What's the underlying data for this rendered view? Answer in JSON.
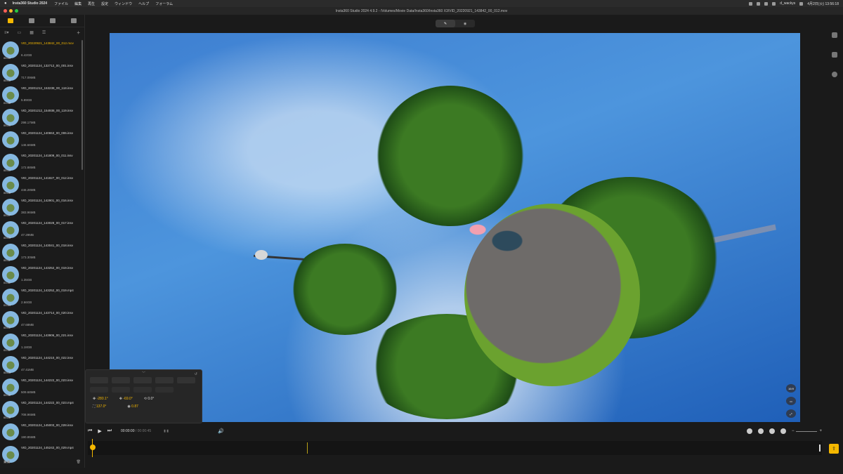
{
  "menubar": {
    "app_name": "Insta360 Studio 2024",
    "menus": [
      "ファイル",
      "編集",
      "再生",
      "設定",
      "ウィンドウ",
      "ヘルプ",
      "フォーラム"
    ],
    "user": "d_wackys",
    "datetime": "4月2日(火) 13:56:18"
  },
  "window": {
    "title": "Insta360 Studio 2024 4.9.2 - /Volumes/Movie Data/Insta360/Insta360 X3/VID_20220921_143842_00_012.mov"
  },
  "sidebar": {
    "files": [
      {
        "name": "VID_20220921_143842_00_012.mov",
        "size": "6.42GB",
        "duration": "00:45",
        "selected": true
      },
      {
        "name": "VID_20201124_132712_00_001.insv",
        "size": "717.09MB",
        "duration": "00:05"
      },
      {
        "name": "VID_20201212_153238_00_118.insv",
        "size": "5.89GB",
        "duration": "01:48"
      },
      {
        "name": "VID_20201212_154938_00_119.insv",
        "size": "298.17MB",
        "duration": "00:20"
      },
      {
        "name": "VID_20201124_140653_00_006.insv",
        "size": "146.66MB",
        "duration": ""
      },
      {
        "name": "VID_20201124_141809_00_011.insv",
        "size": "172.88MB",
        "duration": "00:10"
      },
      {
        "name": "VID_20201124_141827_00_012.insv",
        "size": "446.28MB",
        "duration": "00:26"
      },
      {
        "name": "VID_20201124_142901_00_016.insv",
        "size": "383.96MB",
        "duration": "00:27"
      },
      {
        "name": "VID_20201124_143028_00_017.insv",
        "size": "47.29MB",
        "duration": "00:03"
      },
      {
        "name": "VID_20201124_143041_00_018.insv",
        "size": "173.30MB",
        "duration": "00:11"
      },
      {
        "name": "VID_20201124_143252_00_019.insv",
        "size": "1.35GB",
        "duration": "01:31"
      },
      {
        "name": "VID_20201124_143252_00_019.mp4",
        "size": "2.66GB",
        "duration": "01:44"
      },
      {
        "name": "VID_20201124_143714_00_020.insv",
        "size": "47.68MB",
        "duration": "00:01"
      },
      {
        "name": "VID_20201124_143906_00_021.insv",
        "size": "1.18GB",
        "duration": "01:31"
      },
      {
        "name": "VID_20201124_144210_00_022.insv",
        "size": "47.41MB",
        "duration": "00:03"
      },
      {
        "name": "VID_20201124_144222_00_023.insv",
        "size": "509.68MB",
        "duration": "00:36"
      },
      {
        "name": "VID_20201124_144222_00_023.mp4",
        "size": "708.96MB",
        "duration": "00:28"
      },
      {
        "name": "VID_20201124_145003_00_028.insv",
        "size": "190.85MB",
        "duration": ""
      },
      {
        "name": "VID_20201124_145242_00_029.mp4",
        "size": "",
        "duration": ""
      }
    ]
  },
  "viewer": {
    "aspect_label": "16:9"
  },
  "panel": {
    "pan": "-280.1°",
    "tilt": "-69.0°",
    "roll": "0.0°",
    "fov": "137.0°",
    "distance": "0.87"
  },
  "transport": {
    "current_time": "00:00:00",
    "duration": "/ 00:00:45"
  },
  "colors": {
    "accent": "#f5b800",
    "background": "#1a1a1a"
  }
}
